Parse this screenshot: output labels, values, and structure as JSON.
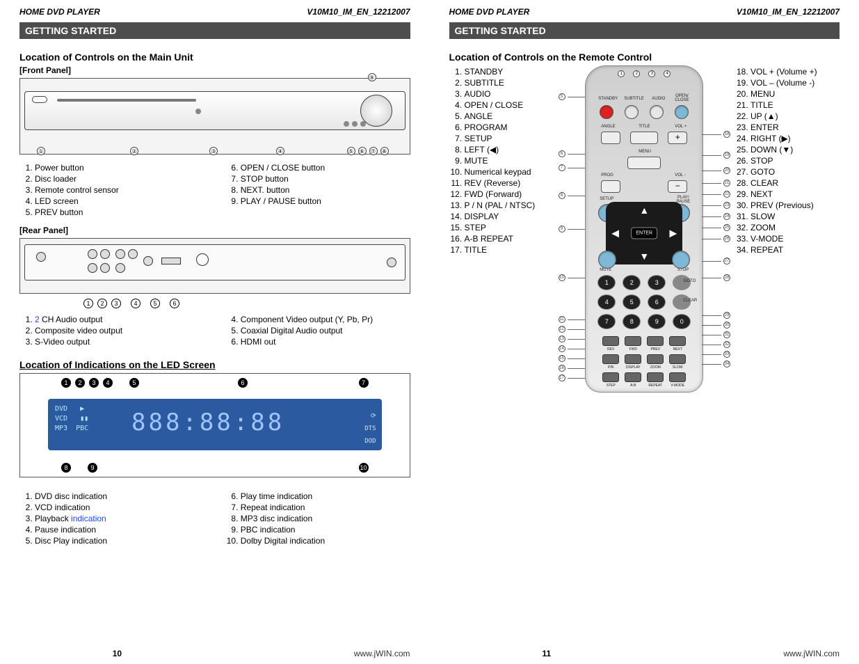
{
  "doc": {
    "product": "HOME DVD PLAYER",
    "docId": "V10M10_IM_EN_12212007",
    "sectionBar": "GETTING STARTED",
    "website": "www.jWIN.com"
  },
  "left": {
    "pageNum": "10",
    "title1": "Location of Controls on the Main Unit",
    "frontLabel": "[Front Panel]",
    "frontList1": [
      "Power button",
      "Disc loader",
      "Remote control sensor",
      "LED screen",
      "PREV button"
    ],
    "frontList2Start": 6,
    "frontList2": [
      "OPEN / CLOSE button",
      "STOP button",
      "NEXT. button",
      "PLAY / PAUSE button"
    ],
    "rearLabel": "[Rear Panel]",
    "rearList1": [
      {
        "pre": "",
        "blue": "2",
        "post": " CH Audio output"
      },
      {
        "pre": "Composite video output",
        "blue": "",
        "post": ""
      },
      {
        "pre": "S-Video output",
        "blue": "",
        "post": ""
      }
    ],
    "rearList2Start": 4,
    "rearList2": [
      "Component Video output (Y, Pb, Pr)",
      "Coaxial Digital Audio output",
      "HDMI out"
    ],
    "title2": "Location of Indications on the LED Screen",
    "ledList1": [
      "DVD disc indication",
      "VCD indication",
      {
        "pre": "Playback ",
        "blue": "indication",
        "post": ""
      },
      "Pause indication",
      "Disc Play indication"
    ],
    "ledList2Start": 6,
    "ledList2": [
      "Play time indication",
      "Repeat indication",
      "MP3 disc indication",
      "PBC indication",
      "Dolby Digital indication"
    ],
    "ledPanel": {
      "left": "DVD   ▶\nVCD   ▮▮\nMP3  PBC",
      "digits": "888:88:88",
      "right": "⟳\nDTS\nDOD"
    }
  },
  "right": {
    "pageNum": "11",
    "title1": "Location of Controls on the Remote Control",
    "remoteLeft": [
      "STANDBY",
      "SUBTITLE",
      "AUDIO",
      "OPEN / CLOSE",
      "ANGLE",
      "PROGRAM",
      "SETUP",
      "LEFT (◀)",
      "MUTE",
      "Numerical keypad",
      "REV (Reverse)",
      "FWD (Forward)",
      "P / N (PAL / NTSC)",
      "DISPLAY",
      "STEP",
      "A-B REPEAT",
      "TITLE"
    ],
    "remoteRightStart": 18,
    "remoteRight": [
      "VOL + (Volume +)",
      "VOL – (Volume -)",
      "MENU",
      "TITLE",
      "UP (▲)",
      "ENTER",
      "RIGHT (▶)",
      "DOWN (▼)",
      "STOP",
      "GOTO",
      "CLEAR",
      "NEXT",
      "PREV (Previous)",
      "SLOW",
      "ZOOM",
      "V-MODE",
      "REPEAT"
    ],
    "remoteLabels": {
      "topRow": [
        "STANDBY",
        "SUBTITLE",
        "AUDIO",
        "OPEN/\nCLOSE"
      ],
      "row2": [
        "ANGLE",
        "TITLE",
        "VOL +"
      ],
      "menu": "MENU",
      "volMinus": "VOL -",
      "prog": "PROG",
      "setup": "SETUP",
      "playPause": "PLAY/\nPAUSE",
      "mute": "MUTE",
      "stop": "STOP",
      "enter": "ENTER",
      "keypadSide": [
        "GOTO",
        "CLEAR"
      ],
      "bottomRows": [
        [
          "◀◀",
          "▶▶",
          "▮◀◀",
          "▶▶▮"
        ],
        [
          "REV",
          "FWD",
          "PREV",
          "NEXT"
        ],
        [
          "P/N",
          "DISPLAY",
          "ZOOM",
          "SLOW"
        ],
        [
          "STEP",
          "A-B",
          "REPEAT",
          "V-MODE"
        ]
      ]
    }
  }
}
